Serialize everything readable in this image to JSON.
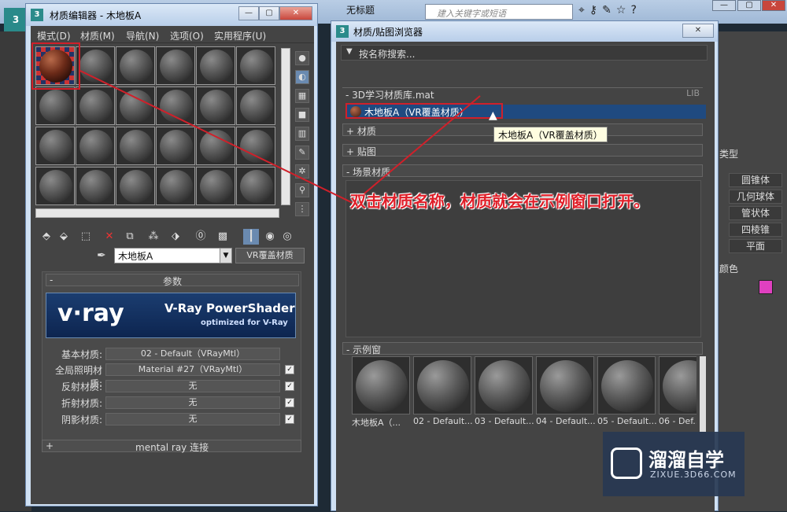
{
  "main_window": {
    "title": "无标题",
    "search_placeholder": "建入关键字或短语"
  },
  "material_editor": {
    "title": "材质编辑器 - 木地板A",
    "menu": [
      "模式(D)",
      "材质(M)",
      "导航(N)",
      "选项(O)",
      "实用程序(U)"
    ],
    "material_name": "木地板A",
    "material_type": "VR覆盖材质",
    "params_header": "参数",
    "vray_logo": "v·ray",
    "vray_line1": "V-Ray PowerShader",
    "vray_line2": "optimized for V-Ray",
    "params": [
      {
        "label": "基本材质:",
        "value": "02 - Default（VRayMtl）",
        "checkbox": false
      },
      {
        "label": "全局照明材质:",
        "value": "Material #27（VRayMtl）",
        "checkbox": true
      },
      {
        "label": "反射材质:",
        "value": "无",
        "checkbox": true
      },
      {
        "label": "折射材质:",
        "value": "无",
        "checkbox": true
      },
      {
        "label": "阴影材质:",
        "value": "无",
        "checkbox": true
      }
    ],
    "mental_ray": "mental ray 连接",
    "mental_ray_sign": "+",
    "collapse_sign": "-"
  },
  "browser": {
    "title": "材质/贴图浏览器",
    "search_placeholder": "按名称搜索...",
    "library_header": "- 3D学习材质库.mat",
    "library_tag": "LIB",
    "library_item": "木地板A（VR覆盖材质）",
    "tooltip": "木地板A（VR覆盖材质）",
    "rollouts": {
      "materials": "+ 材质",
      "maps": "+ 贴图",
      "scene": "- 场景材质",
      "samples": "- 示例窗"
    },
    "samples": [
      "木地板A（...",
      "02 - Default...",
      "03 - Default...",
      "04 - Default...",
      "05 - Default...",
      "06 - Def..."
    ]
  },
  "right_panel": {
    "type_label": "类型",
    "items": [
      "圆锥体",
      "几何球体",
      "管状体",
      "四棱锥",
      "平面"
    ],
    "color_label": "颜色",
    "accent_color": "#e040c0"
  },
  "annotation": "双击材质名称，材质就会在示例窗口打开。",
  "watermark": {
    "cn": "溜溜自学",
    "en": "ZIXUE.3D66.COM"
  }
}
